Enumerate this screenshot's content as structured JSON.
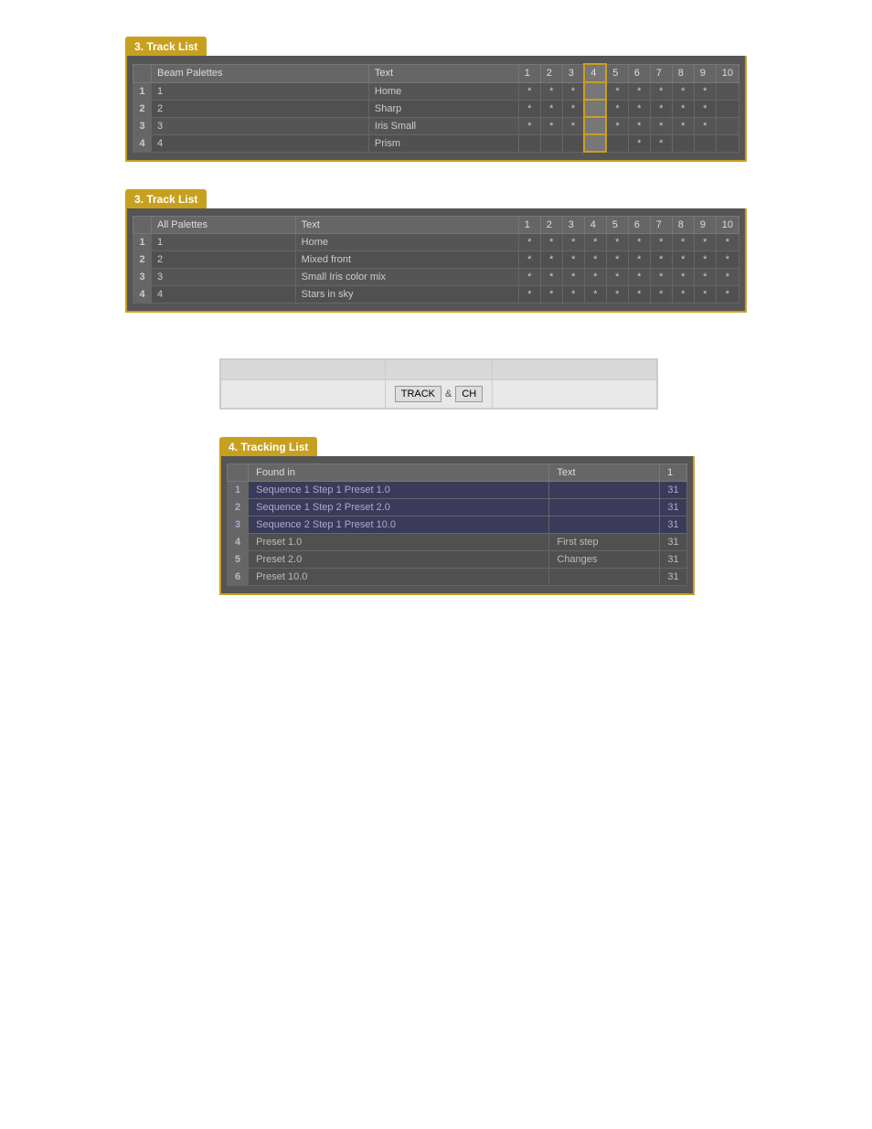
{
  "panel1": {
    "title": "3. Track List",
    "columns": [
      "Beam Palettes",
      "Text",
      "1",
      "2",
      "3",
      "4",
      "5",
      "6",
      "7",
      "8",
      "9",
      "10"
    ],
    "highlighted_col": "4",
    "rows": [
      {
        "num": "1",
        "palette": "1",
        "text": "Home",
        "cells": [
          "*",
          "*",
          "*",
          "",
          "*",
          "*",
          "*",
          "*",
          "*",
          ""
        ]
      },
      {
        "num": "2",
        "palette": "2",
        "text": "Sharp",
        "cells": [
          "*",
          "*",
          "*",
          "",
          "*",
          "*",
          "*",
          "*",
          "*",
          ""
        ]
      },
      {
        "num": "3",
        "palette": "3",
        "text": "Iris Small",
        "cells": [
          "*",
          "*",
          "*",
          "",
          "*",
          "*",
          "*",
          "*",
          "*",
          ""
        ]
      },
      {
        "num": "4",
        "palette": "4",
        "text": "Prism",
        "cells": [
          "",
          "",
          "",
          "",
          "",
          "*",
          "*",
          "",
          "",
          ""
        ]
      }
    ]
  },
  "panel2": {
    "title": "3. Track List",
    "columns": [
      "All Palettes",
      "Text",
      "1",
      "2",
      "3",
      "4",
      "5",
      "6",
      "7",
      "8",
      "9",
      "10"
    ],
    "rows": [
      {
        "num": "1",
        "palette": "1",
        "text": "Home",
        "cells": [
          "*",
          "*",
          "*",
          "*",
          "*",
          "*",
          "*",
          "*",
          "*",
          "*"
        ]
      },
      {
        "num": "2",
        "palette": "2",
        "text": "Mixed front",
        "cells": [
          "*",
          "*",
          "*",
          "*",
          "*",
          "*",
          "*",
          "*",
          "*",
          "*"
        ]
      },
      {
        "num": "3",
        "palette": "3",
        "text": "Small Iris color mix",
        "cells": [
          "*",
          "*",
          "*",
          "*",
          "*",
          "*",
          "*",
          "*",
          "*",
          "*"
        ]
      },
      {
        "num": "4",
        "palette": "4",
        "text": "Stars in sky",
        "cells": [
          "*",
          "*",
          "*",
          "*",
          "*",
          "*",
          "*",
          "*",
          "*",
          "*"
        ]
      }
    ]
  },
  "filter": {
    "track_label": "TRACK",
    "amp_label": "&",
    "ch_label": "CH"
  },
  "panel3": {
    "title": "4. Tracking List",
    "columns": [
      "Found in",
      "Text",
      "1"
    ],
    "rows": [
      {
        "num": "1",
        "found_in": "Sequence 1 Step 1 Preset 1.0",
        "text": "",
        "val": "31",
        "highlight": true
      },
      {
        "num": "2",
        "found_in": "Sequence 1 Step 2 Preset 2.0",
        "text": "",
        "val": "31",
        "highlight": true
      },
      {
        "num": "3",
        "found_in": "Sequence 2 Step 1 Preset 10.0",
        "text": "",
        "val": "31",
        "highlight": true
      },
      {
        "num": "4",
        "found_in": "Preset 1.0",
        "text": "First step",
        "val": "31",
        "highlight": false
      },
      {
        "num": "5",
        "found_in": "Preset 2.0",
        "text": "Changes",
        "val": "31",
        "highlight": false
      },
      {
        "num": "6",
        "found_in": "Preset 10.0",
        "text": "",
        "val": "31",
        "highlight": false
      }
    ]
  }
}
